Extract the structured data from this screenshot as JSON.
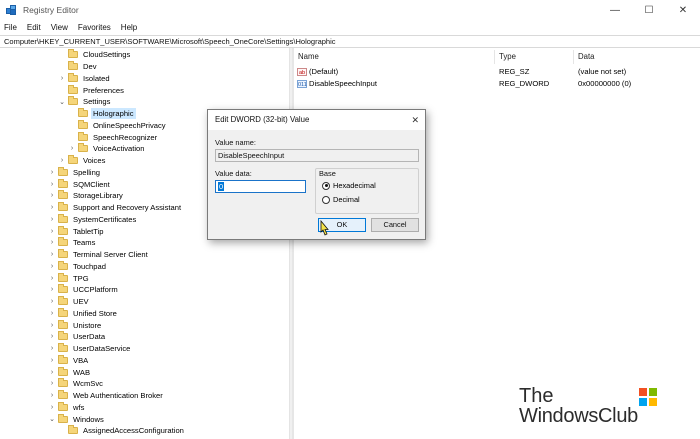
{
  "window": {
    "title": "Registry Editor",
    "controls": {
      "minimize": "—",
      "maximize": "☐",
      "close": "✕"
    }
  },
  "menu": [
    "File",
    "Edit",
    "View",
    "Favorites",
    "Help"
  ],
  "address": "Computer\\HKEY_CURRENT_USER\\SOFTWARE\\Microsoft\\Speech_OneCore\\Settings\\Holographic",
  "tree": [
    {
      "label": "CloudSettings",
      "chevron": ""
    },
    {
      "label": "Dev",
      "chevron": ""
    },
    {
      "label": "Isolated",
      "chevron": "›"
    },
    {
      "label": "Preferences",
      "chevron": ""
    },
    {
      "label": "Settings",
      "chevron": "⌄"
    },
    {
      "label": "Holographic",
      "chevron": "",
      "selected": true
    },
    {
      "label": "OnlineSpeechPrivacy",
      "chevron": ""
    },
    {
      "label": "SpeechRecognizer",
      "chevron": ""
    },
    {
      "label": "VoiceActivation",
      "chevron": "›"
    },
    {
      "label": "Voices",
      "chevron": "›"
    },
    {
      "label": "Spelling",
      "chevron": "›"
    },
    {
      "label": "SQMClient",
      "chevron": "›"
    },
    {
      "label": "StorageLibrary",
      "chevron": "›"
    },
    {
      "label": "Support and Recovery Assistant",
      "chevron": "›"
    },
    {
      "label": "SystemCertificates",
      "chevron": "›"
    },
    {
      "label": "TabletTip",
      "chevron": "›"
    },
    {
      "label": "Teams",
      "chevron": "›"
    },
    {
      "label": "Terminal Server Client",
      "chevron": "›"
    },
    {
      "label": "Touchpad",
      "chevron": "›"
    },
    {
      "label": "TPG",
      "chevron": "›"
    },
    {
      "label": "UCCPlatform",
      "chevron": "›"
    },
    {
      "label": "UEV",
      "chevron": "›"
    },
    {
      "label": "Unified Store",
      "chevron": "›"
    },
    {
      "label": "Unistore",
      "chevron": "›"
    },
    {
      "label": "UserData",
      "chevron": "›"
    },
    {
      "label": "UserDataService",
      "chevron": "›"
    },
    {
      "label": "VBA",
      "chevron": "›"
    },
    {
      "label": "WAB",
      "chevron": "›"
    },
    {
      "label": "WcmSvc",
      "chevron": "›"
    },
    {
      "label": "Web Authentication Broker",
      "chevron": "›"
    },
    {
      "label": "wfs",
      "chevron": "›"
    },
    {
      "label": "Windows",
      "chevron": "⌄"
    },
    {
      "label": "AssignedAccessConfiguration",
      "chevron": ""
    }
  ],
  "values": {
    "headers": {
      "name": "Name",
      "type": "Type",
      "data": "Data"
    },
    "rows": [
      {
        "icon": "ab",
        "name": "(Default)",
        "type": "REG_SZ",
        "data": "(value not set)"
      },
      {
        "icon": "011",
        "name": "DisableSpeechInput",
        "type": "REG_DWORD",
        "data": "0x00000000 (0)"
      }
    ]
  },
  "dialog": {
    "title": "Edit DWORD (32-bit) Value",
    "close": "✕",
    "value_name_label": "Value name:",
    "value_name": "DisableSpeechInput",
    "value_data_label": "Value data:",
    "value_data": "0",
    "base_label": "Base",
    "hex_label": "Hexadecimal",
    "dec_label": "Decimal",
    "base_selected": "Hexadecimal",
    "ok": "OK",
    "cancel": "Cancel"
  },
  "watermark": {
    "line1": "The",
    "line2": "WindowsClub"
  }
}
